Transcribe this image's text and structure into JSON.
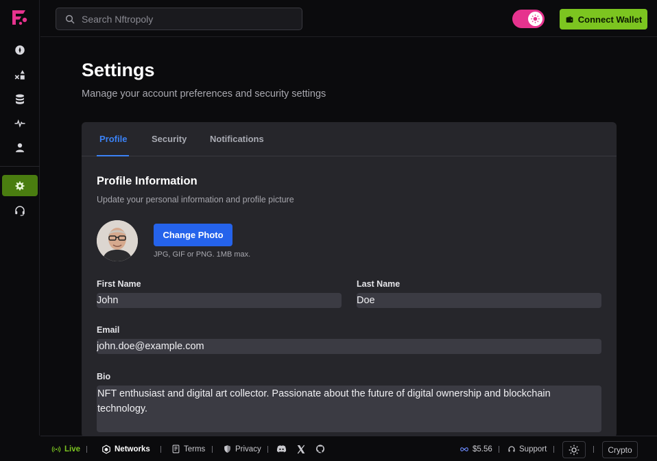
{
  "app": {
    "brand_color": "#e6338e",
    "accent_green": "#7cc520",
    "accent_blue": "#3b82f6"
  },
  "sidebar": {
    "items": [
      {
        "icon": "compass-icon"
      },
      {
        "icon": "shapes-icon"
      },
      {
        "icon": "database-icon"
      },
      {
        "icon": "activity-icon"
      },
      {
        "icon": "user-icon"
      },
      {
        "icon": "gear-icon",
        "active": true
      },
      {
        "icon": "headset-icon"
      }
    ]
  },
  "topbar": {
    "search_placeholder": "Search Nftropoly",
    "connect_label": "Connect Wallet"
  },
  "page": {
    "title": "Settings",
    "subtitle": "Manage your account preferences and security settings"
  },
  "tabs": [
    {
      "label": "Profile",
      "active": true
    },
    {
      "label": "Security"
    },
    {
      "label": "Notifications"
    }
  ],
  "profile": {
    "title": "Profile Information",
    "subtitle": "Update your personal information and profile picture",
    "change_photo_label": "Change Photo",
    "photo_hint": "JPG, GIF or PNG. 1MB max.",
    "first_name_label": "First Name",
    "first_name": "John",
    "last_name_label": "Last Name",
    "last_name": "Doe",
    "email_label": "Email",
    "email": "john.doe@example.com",
    "bio_label": "Bio",
    "bio": "NFT enthusiast and digital art collector. Passionate about the future of digital ownership and blockchain technology."
  },
  "footer": {
    "live": "Live",
    "networks": "Networks",
    "terms": "Terms",
    "privacy": "Privacy",
    "price": "$5.56",
    "support": "Support",
    "currency": "Crypto"
  }
}
